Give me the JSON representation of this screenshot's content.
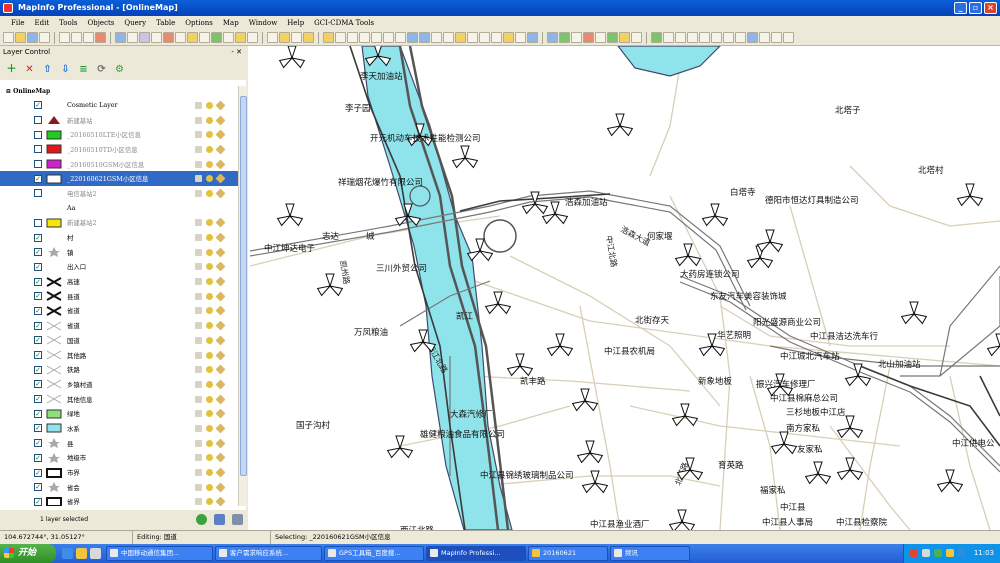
{
  "window": {
    "title": "MapInfo Professional - [OnlineMap]",
    "buttons": [
      "_",
      "▫",
      "×"
    ]
  },
  "menu": [
    "File",
    "Edit",
    "Tools",
    "Objects",
    "Query",
    "Table",
    "Options",
    "Map",
    "Window",
    "Help",
    "GCI-CDMA Tools"
  ],
  "layer_control": {
    "title": "Layer Control",
    "header_buttons": "- ✕",
    "root": "OnlineMap",
    "layers": [
      {
        "name": "Cosmetic Layer",
        "checked": true,
        "dim": false,
        "symbol": "none"
      },
      {
        "name": "新建基站",
        "checked": false,
        "dim": true,
        "symbol": "red-triangle"
      },
      {
        "name": "_20160510LTE小区信息",
        "checked": false,
        "dim": true,
        "symbol": "green-rect"
      },
      {
        "name": "_20160510TD小区信息",
        "checked": false,
        "dim": true,
        "symbol": "red-rect"
      },
      {
        "name": "_20160510GSM小区信息",
        "checked": false,
        "dim": true,
        "symbol": "magenta-rect"
      },
      {
        "name": "_220160621GSM小区信息",
        "checked": true,
        "dim": false,
        "symbol": "white-rect",
        "selected": true
      },
      {
        "name": "电信基站2",
        "checked": false,
        "dim": true,
        "symbol": "none"
      },
      {
        "name": "Aa",
        "checked": null,
        "dim": false,
        "symbol": "none",
        "label_row": true
      },
      {
        "name": "新建基站2",
        "checked": false,
        "dim": true,
        "symbol": "yellow-rect"
      },
      {
        "name": "村",
        "checked": true,
        "dim": false,
        "symbol": "none"
      },
      {
        "name": "镇",
        "checked": true,
        "dim": false,
        "symbol": "gray-star"
      },
      {
        "name": "出入口",
        "checked": true,
        "dim": false,
        "symbol": "none"
      },
      {
        "name": "高速",
        "checked": true,
        "dim": false,
        "symbol": "cross-black"
      },
      {
        "name": "县道",
        "checked": true,
        "dim": false,
        "symbol": "cross-black"
      },
      {
        "name": "省道",
        "checked": true,
        "dim": false,
        "symbol": "cross-black"
      },
      {
        "name": "省道",
        "checked": true,
        "dim": false,
        "symbol": "cross-gray"
      },
      {
        "name": "国道",
        "checked": true,
        "dim": false,
        "symbol": "cross-gray"
      },
      {
        "name": "其他路",
        "checked": true,
        "dim": false,
        "symbol": "cross-gray"
      },
      {
        "name": "铁路",
        "checked": true,
        "dim": false,
        "symbol": "cross-gray"
      },
      {
        "name": "乡镇村道",
        "checked": true,
        "dim": false,
        "symbol": "cross-gray"
      },
      {
        "name": "其他信息",
        "checked": true,
        "dim": false,
        "symbol": "cross-gray"
      },
      {
        "name": "绿地",
        "checked": true,
        "dim": false,
        "symbol": "green-fill"
      },
      {
        "name": "水系",
        "checked": true,
        "dim": false,
        "symbol": "cyan-fill"
      },
      {
        "name": "县",
        "checked": true,
        "dim": false,
        "symbol": "gray-star"
      },
      {
        "name": "地级市",
        "checked": true,
        "dim": false,
        "symbol": "gray-star"
      },
      {
        "name": "市界",
        "checked": true,
        "dim": false,
        "symbol": "border-black"
      },
      {
        "name": "省会",
        "checked": true,
        "dim": false,
        "symbol": "gray-star"
      },
      {
        "name": "省界",
        "checked": true,
        "dim": false,
        "symbol": "border-black"
      }
    ],
    "status": "1 layer selected"
  },
  "map_labels": [
    {
      "text": "李天加油站"
    },
    {
      "text": "李子园"
    },
    {
      "text": "北塔子"
    },
    {
      "text": "开元机动车技术性能检测公司"
    },
    {
      "text": "北塔村"
    },
    {
      "text": "祥瑞烟花爆竹有限公司"
    },
    {
      "text": "白塔寺"
    },
    {
      "text": "德阳市恒达灯具制造公司"
    },
    {
      "text": "浩森加油站"
    },
    {
      "text": "何家堰"
    },
    {
      "text": "中江坤达电子"
    },
    {
      "text": "志达"
    },
    {
      "text": "城"
    },
    {
      "text": "三川外贸公司"
    },
    {
      "text": "大药房连锁公司"
    },
    {
      "text": "东友汽车美容装饰城"
    },
    {
      "text": "万凤粮油"
    },
    {
      "text": "凯江"
    },
    {
      "text": "北街存天"
    },
    {
      "text": "阳光盛源商业公司"
    },
    {
      "text": "中江县洁达洗车行"
    },
    {
      "text": "华艺照明"
    },
    {
      "text": "中江县农机局"
    },
    {
      "text": "中江城北汽车站"
    },
    {
      "text": "北山加油站"
    },
    {
      "text": "凯丰路"
    },
    {
      "text": "新象地板"
    },
    {
      "text": "振兴汽车修理厂"
    },
    {
      "text": "中江县棉麻总公司"
    },
    {
      "text": "三杉地板中江店"
    },
    {
      "text": "南方家私"
    },
    {
      "text": "大森汽修厂"
    },
    {
      "text": "国子沟村"
    },
    {
      "text": "雄健粮油食品有限公司"
    },
    {
      "text": "中江供电公"
    },
    {
      "text": "友家私"
    },
    {
      "text": "育英路"
    },
    {
      "text": "中江县锦绣玻璃制品公司"
    },
    {
      "text": "中江县人事局"
    },
    {
      "text": "中江县检察院"
    },
    {
      "text": "中江县渔业酒厂"
    },
    {
      "text": "福家私"
    },
    {
      "text": "中江县"
    },
    {
      "text": "西江北路"
    }
  ],
  "road_labels": [
    {
      "text": "西江北路"
    },
    {
      "text": "浩森大道"
    },
    {
      "text": "中江北路"
    },
    {
      "text": "凯州路"
    },
    {
      "text": "北塔路"
    }
  ],
  "statusbar": {
    "coords": "104.672744°, 31.05127°",
    "editing": "Editing: 国道",
    "selecting": "Selecting: _220160621GSM小区信息"
  },
  "taskbar": {
    "start": "开始",
    "tasks": [
      {
        "label": "中国移动通信集团..."
      },
      {
        "label": "客户需求响应系统..."
      },
      {
        "label": "GPS工具箱_百度搜..."
      },
      {
        "label": "MapInfo Professi..."
      },
      {
        "label": "20160621"
      },
      {
        "label": "频讯"
      }
    ],
    "clock": "11:03"
  }
}
